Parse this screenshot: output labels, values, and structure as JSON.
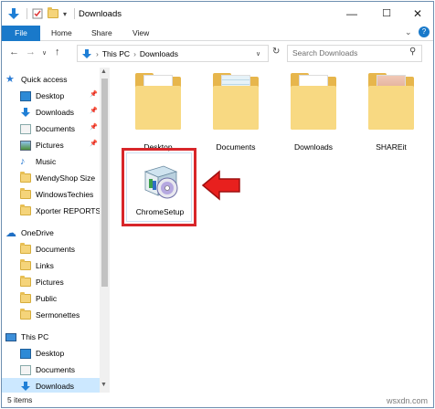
{
  "window": {
    "title": "Downloads",
    "minimize": "—",
    "maximize": "☐",
    "close": "✕"
  },
  "ribbon": {
    "tabs": [
      "File",
      "Home",
      "Share",
      "View"
    ]
  },
  "address": {
    "segments": [
      "This PC",
      "Downloads"
    ],
    "search_placeholder": "Search Downloads"
  },
  "sidebar": {
    "items": [
      {
        "label": "Quick access",
        "icon": "star-icon",
        "pinned": false
      },
      {
        "label": "Desktop",
        "icon": "desktop-icon",
        "pinned": true
      },
      {
        "label": "Downloads",
        "icon": "download-arrow-icon",
        "pinned": true
      },
      {
        "label": "Documents",
        "icon": "documents-icon",
        "pinned": true
      },
      {
        "label": "Pictures",
        "icon": "pictures-icon",
        "pinned": true
      },
      {
        "label": "Music",
        "icon": "music-icon",
        "pinned": false
      },
      {
        "label": "WendyShop Size",
        "icon": "folder-icon",
        "pinned": false
      },
      {
        "label": "WindowsTechies",
        "icon": "folder-icon",
        "pinned": false
      },
      {
        "label": "Xporter REPORTS",
        "icon": "folder-icon",
        "pinned": false
      },
      {
        "label": "OneDrive",
        "icon": "onedrive-icon",
        "pinned": false
      },
      {
        "label": "Documents",
        "icon": "folder-icon",
        "pinned": false
      },
      {
        "label": "Links",
        "icon": "folder-icon",
        "pinned": false
      },
      {
        "label": "Pictures",
        "icon": "folder-icon",
        "pinned": false
      },
      {
        "label": "Public",
        "icon": "folder-icon",
        "pinned": false
      },
      {
        "label": "Sermonettes",
        "icon": "folder-icon",
        "pinned": false
      },
      {
        "label": "This PC",
        "icon": "computer-icon",
        "pinned": false
      },
      {
        "label": "Desktop",
        "icon": "desktop-icon",
        "pinned": false
      },
      {
        "label": "Documents",
        "icon": "documents-icon",
        "pinned": false
      },
      {
        "label": "Downloads",
        "icon": "download-arrow-icon",
        "pinned": false
      }
    ],
    "selected": "Downloads"
  },
  "content": {
    "folders": [
      "Desktop",
      "Documents",
      "Downloads",
      "SHAREit"
    ],
    "file": "ChromeSetup"
  },
  "status": {
    "items_count": "5 items",
    "watermark": "wsxdn.com"
  },
  "colors": {
    "accent": "#1979ca",
    "highlight": "#d8262a",
    "selection": "#cce8ff",
    "folder": "#f8d982"
  }
}
